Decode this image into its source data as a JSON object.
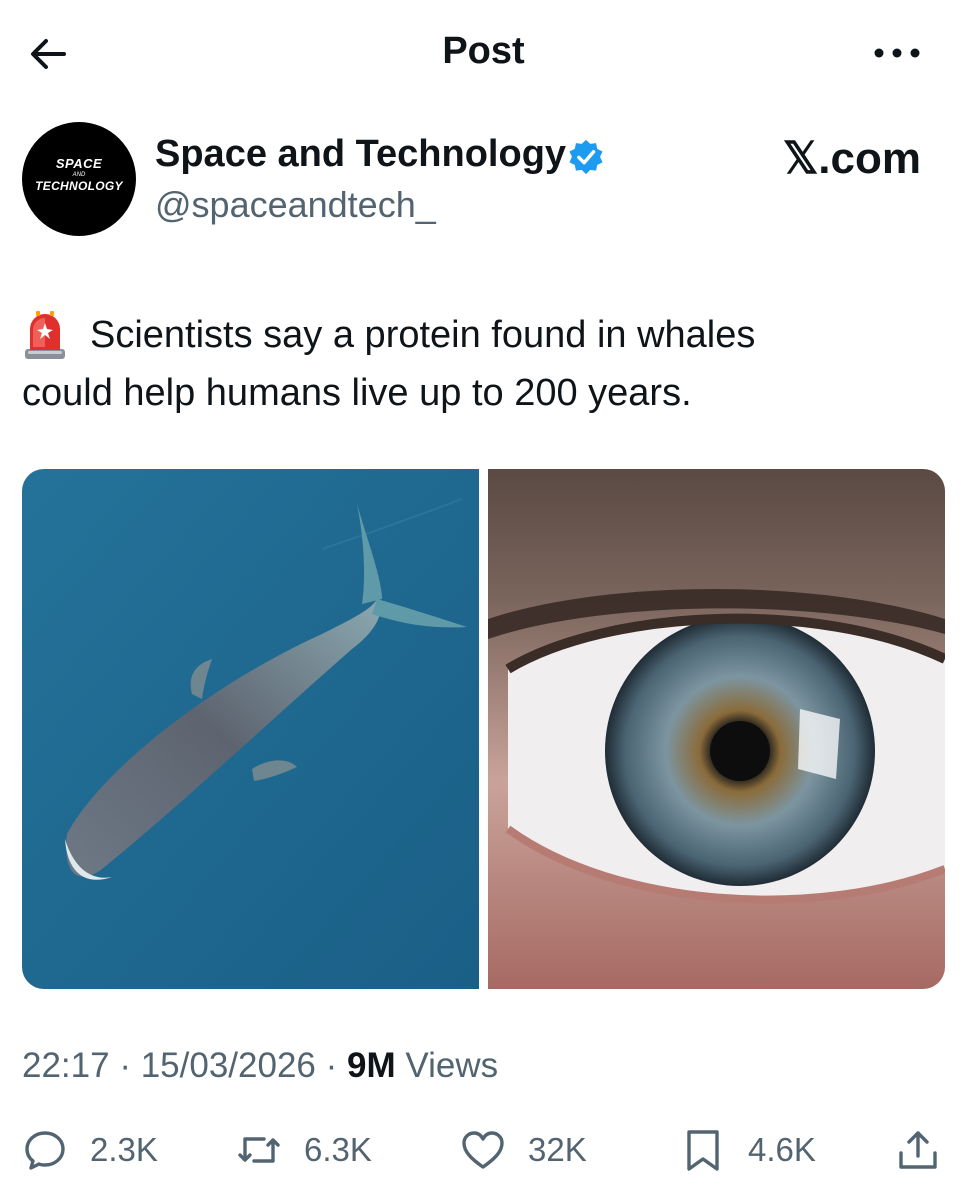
{
  "header": {
    "title": "Post"
  },
  "author": {
    "avatar_lines": [
      "SPACE",
      "AND",
      "TECHNOLOGY"
    ],
    "name": "Space and Technology",
    "handle": "@spaceandtech_",
    "verified": true
  },
  "watermark": "𝕏.com",
  "tweet": {
    "emoji_icon": "police-siren-icon",
    "line1": "Scientists say a protein found in whales",
    "line2": "could help humans live up to 200 years."
  },
  "media": {
    "images": [
      "whale-aerial-photo",
      "human-eye-closeup-photo"
    ]
  },
  "meta": {
    "time": "22:17",
    "date": "15/03/2026",
    "views_count": "9M",
    "views_label": "Views",
    "separator": "·"
  },
  "actions": {
    "replies": "2.3K",
    "reposts": "6.3K",
    "likes": "32K",
    "bookmarks": "4.6K"
  },
  "colors": {
    "text": "#0f1419",
    "muted": "#536471",
    "verified": "#1d9bf0",
    "ocean": "#1f6a93"
  }
}
